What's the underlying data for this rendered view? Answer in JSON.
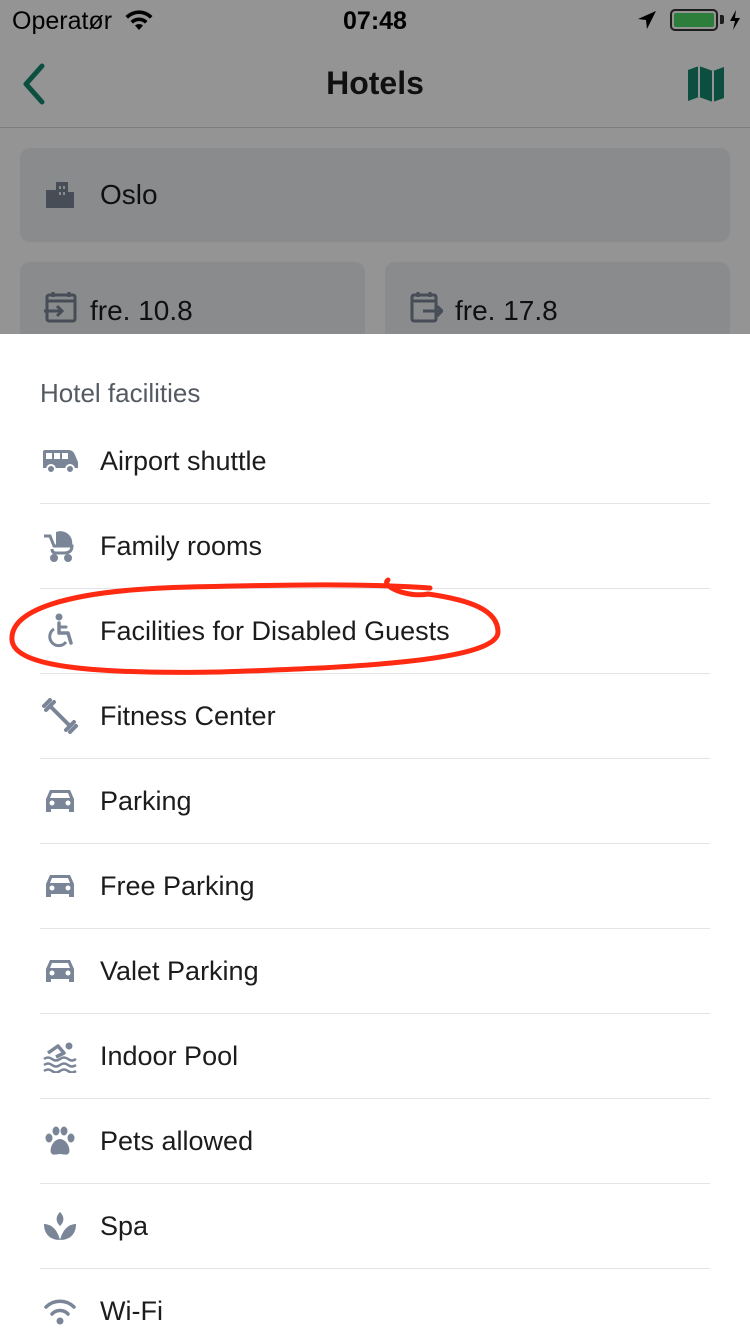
{
  "status_bar": {
    "carrier": "Operatør",
    "time": "07:48"
  },
  "nav": {
    "title": "Hotels"
  },
  "search": {
    "city": "Oslo"
  },
  "dates": {
    "checkin": "fre. 10.8",
    "checkout": "fre. 17.8"
  },
  "sheet": {
    "header": "Hotel facilities",
    "items": [
      {
        "label": "Airport shuttle",
        "icon": "shuttle-icon"
      },
      {
        "label": "Family rooms",
        "icon": "stroller-icon"
      },
      {
        "label": "Facilities for Disabled Guests",
        "icon": "wheelchair-icon"
      },
      {
        "label": "Fitness Center",
        "icon": "dumbbell-icon"
      },
      {
        "label": "Parking",
        "icon": "car-icon"
      },
      {
        "label": "Free Parking",
        "icon": "car-icon"
      },
      {
        "label": "Valet Parking",
        "icon": "car-icon"
      },
      {
        "label": "Indoor Pool",
        "icon": "swimmer-icon"
      },
      {
        "label": "Pets allowed",
        "icon": "paw-icon"
      },
      {
        "label": "Spa",
        "icon": "lotus-icon"
      },
      {
        "label": "Wi-Fi",
        "icon": "wifi-icon"
      }
    ]
  },
  "colors": {
    "accent": "#16896f",
    "icon": "#7a8597",
    "annotation": "#ff2a12",
    "battery": "#4cd964"
  }
}
